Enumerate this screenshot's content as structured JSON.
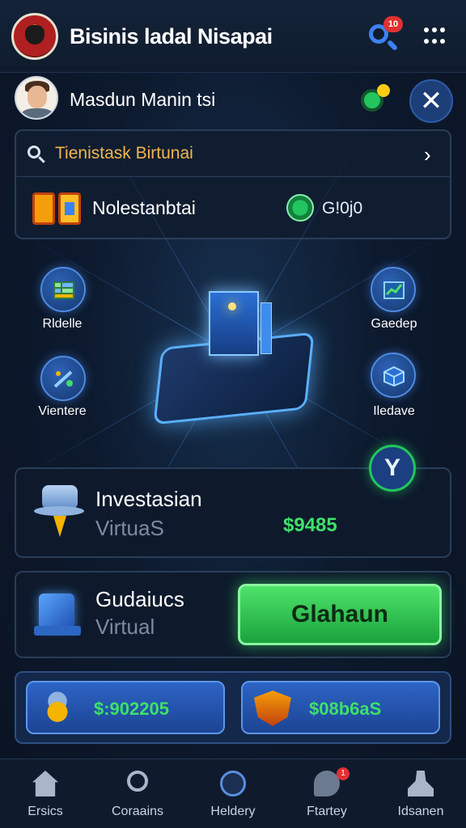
{
  "header": {
    "app_title": "Bisinis ladal Nisapai",
    "notification_badge": "10",
    "logo_icon": "casino-chip-logo-icon",
    "search_icon": "search-icon",
    "menu_icon": "more-dots-icon"
  },
  "user": {
    "name": "Masdun Manin tsi",
    "avatar_icon": "user-avatar-icon",
    "status_icon": "green-coin-icon",
    "close_icon": "close-icon"
  },
  "info_card": {
    "search_text": "Tienistask Birtunai",
    "wallet_title": "Nolestanbtai",
    "coin_value": "G!0j0",
    "wallet_icon": "wallet-icon",
    "coin_icon": "coin-icon",
    "chevron_icon": "chevron-right-icon"
  },
  "hero": {
    "items": [
      {
        "label": "Rldelle",
        "icon": "grid-icon"
      },
      {
        "label": "Gaedep",
        "icon": "chart-icon"
      },
      {
        "label": "Vientere",
        "icon": "tools-icon"
      },
      {
        "label": "Iledave",
        "icon": "cube-icon"
      }
    ],
    "center_icon": "glowing-platform-icon",
    "check_icon": "check-icon"
  },
  "investment_card": {
    "title": "Investasian",
    "subtitle": "VirtuaS",
    "amount": "$9485",
    "icon": "hat-pen-icon"
  },
  "virtual_card": {
    "title": "Gudaiucs",
    "subtitle": "Virtual",
    "button_label": "Glahaun",
    "icon": "cube-stand-icon"
  },
  "rewards": [
    {
      "value": "$:902205",
      "icon": "gold-trophy-icon"
    },
    {
      "value": "$08b6aS",
      "icon": "shield-icon"
    }
  ],
  "nav": [
    {
      "label": "Ersics",
      "icon": "home-icon"
    },
    {
      "label": "Coraains",
      "icon": "search-person-icon"
    },
    {
      "label": "Heldery",
      "icon": "clock-icon"
    },
    {
      "label": "Ftartey",
      "icon": "chat-icon",
      "badge": "1"
    },
    {
      "label": "Idsanen",
      "icon": "person-icon"
    }
  ],
  "colors": {
    "accent_green": "#3ee06a",
    "accent_blue": "#3b82f6",
    "title_amber": "#f2b64c",
    "background": "#0d1a2e"
  }
}
